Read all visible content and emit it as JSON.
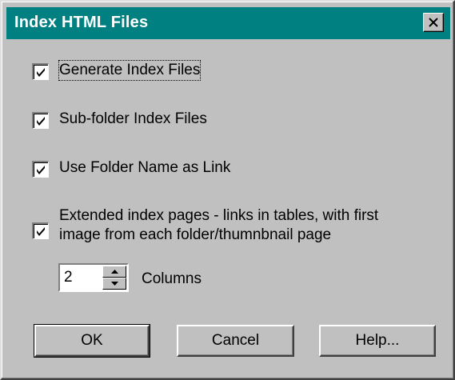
{
  "window": {
    "title": "Index HTML Files",
    "titlebar_color": "#008080"
  },
  "options": {
    "generate_index": {
      "label": "Generate Index Files",
      "checked": true
    },
    "subfolder_index": {
      "label": "Sub-folder Index Files",
      "checked": true
    },
    "folder_name_link": {
      "label": "Use Folder Name as Link",
      "checked": true
    },
    "extended_pages": {
      "label_line1": "Extended index pages - links in tables, with first",
      "label_line2": "image from each folder/thumnbnail page",
      "checked": true
    }
  },
  "columns": {
    "value": "2",
    "label": "Columns"
  },
  "buttons": {
    "ok": "OK",
    "cancel": "Cancel",
    "help": "Help..."
  },
  "icons": {
    "close": "close-icon",
    "check": "check-icon",
    "spin_up": "arrow-up-icon",
    "spin_down": "arrow-down-icon"
  }
}
